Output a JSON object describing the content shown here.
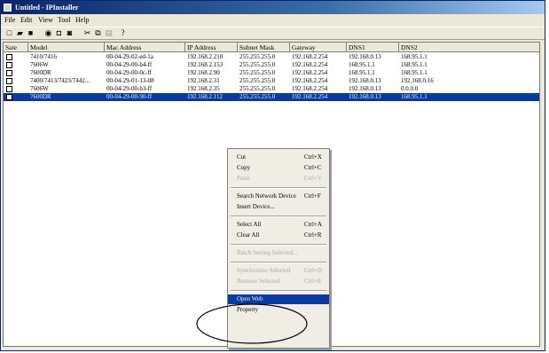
{
  "window": {
    "title": "Untitled - IPInstaller"
  },
  "menubar": [
    "File",
    "Edit",
    "View",
    "Tool",
    "Help"
  ],
  "toolbar": [
    {
      "name": "new-icon",
      "glyph": "□"
    },
    {
      "name": "open-icon",
      "glyph": "▰"
    },
    {
      "name": "save-icon",
      "glyph": "■"
    },
    {
      "name": "search-icon",
      "glyph": "◉"
    },
    {
      "name": "copy-icon",
      "glyph": "◘"
    },
    {
      "name": "paste-icon",
      "glyph": "◙"
    },
    {
      "name": "cut-icon",
      "glyph": "✂"
    },
    {
      "name": "copy2-icon",
      "glyph": "⧉"
    },
    {
      "name": "paste2-icon",
      "glyph": "▤"
    },
    {
      "name": "help-icon",
      "glyph": "?"
    }
  ],
  "table": {
    "columns": [
      "Sate",
      "Model",
      "Mac Address",
      "IP Address",
      "Subnet Mask",
      "Gateway",
      "DNS1",
      "DNS2"
    ],
    "rows": [
      [
        "",
        "7410/7416",
        "00-04-29-02-ed-1a",
        "192.168.2.210",
        "255.255.255.0",
        "192.168.2.254",
        "192.168.0.13",
        "168.95.1.1"
      ],
      [
        "",
        "7606W",
        "00-04-29-00-b4-ff",
        "192.168.2.153",
        "255.255.255.0",
        "192.168.2.254",
        "168.95.1.1",
        "168.95.1.1"
      ],
      [
        "",
        "7600DR",
        "00-04-29-00-0c-ff",
        "192.168.2.90",
        "255.255.255.0",
        "192.168.2.254",
        "168.95.1.1",
        "168.95.1.1"
      ],
      [
        "",
        "7400/7413/7423/7442...",
        "00-04-29-01-13-08",
        "192.168.2.31",
        "255.255.255.0",
        "192.168.2.254",
        "192.168.0.13",
        "192.168.0.16"
      ],
      [
        "",
        "7606W",
        "00-04-29-00-b3-ff",
        "192.168.2.35",
        "255.255.255.0",
        "192.168.2.254",
        "192.168.0.13",
        "0.0.0.0"
      ],
      [
        "",
        "7600DR",
        "00-04-29-00-90-ff",
        "192.168.2.112",
        "255.255.255.0",
        "192.168.2.254",
        "192.168.0.13",
        "168.95.1.1"
      ]
    ],
    "selected_row": 5
  },
  "context_menu": [
    {
      "label": "Cut",
      "shortcut": "Ctrl+X",
      "disabled": false
    },
    {
      "label": "Copy",
      "shortcut": "Ctrl+C",
      "disabled": false
    },
    {
      "label": "Paste",
      "shortcut": "Ctrl+V",
      "disabled": true
    },
    {
      "sep": true
    },
    {
      "label": "Search Network Device",
      "shortcut": "Ctrl+F",
      "disabled": false
    },
    {
      "label": "Insert Device...",
      "shortcut": "",
      "disabled": false
    },
    {
      "sep": true
    },
    {
      "label": "Select All",
      "shortcut": "Ctrl+A",
      "disabled": false
    },
    {
      "label": "Clear All",
      "shortcut": "Ctrl+R",
      "disabled": false
    },
    {
      "sep": true
    },
    {
      "label": "Batch Setting Selected...",
      "shortcut": "",
      "disabled": true
    },
    {
      "sep": true
    },
    {
      "label": "Synchronize Selected",
      "shortcut": "Ctrl+D",
      "disabled": true
    },
    {
      "label": "Remove Selected",
      "shortcut": "Ctrl+E",
      "disabled": true
    },
    {
      "sep": true
    },
    {
      "label": "Open Web",
      "shortcut": "",
      "disabled": false,
      "highlight": true
    },
    {
      "label": "Property",
      "shortcut": "",
      "disabled": false
    }
  ]
}
